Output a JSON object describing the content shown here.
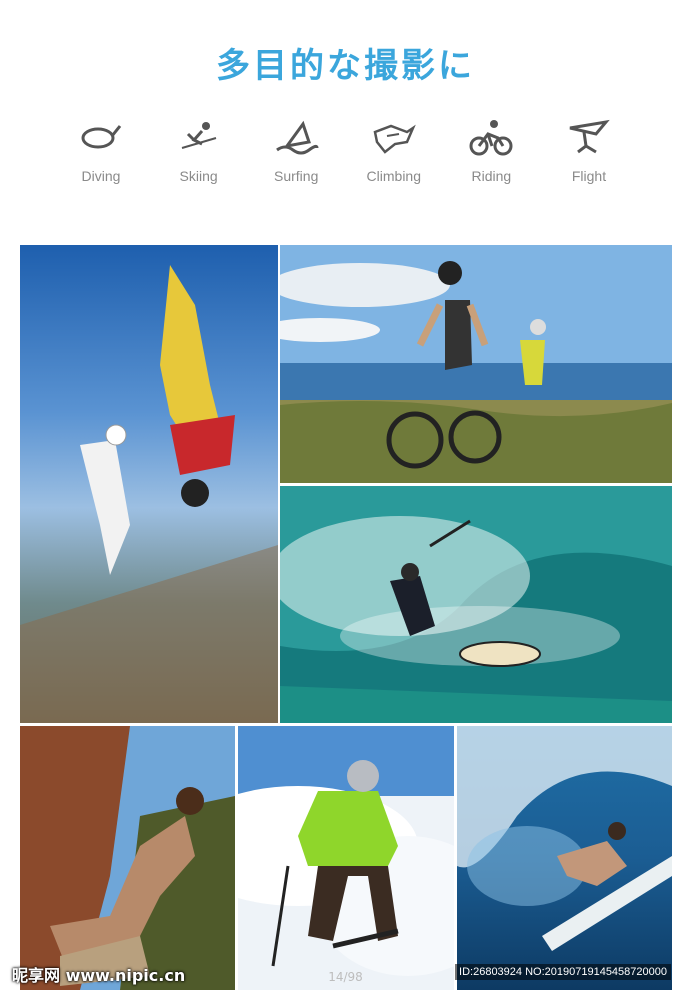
{
  "title": "多目的な撮影に",
  "activities": [
    {
      "label": "Diving",
      "icon": "diving-icon"
    },
    {
      "label": "Skiing",
      "icon": "skiing-icon"
    },
    {
      "label": "Surfing",
      "icon": "surfing-icon"
    },
    {
      "label": "Climbing",
      "icon": "climbing-icon"
    },
    {
      "label": "Riding",
      "icon": "riding-icon"
    },
    {
      "label": "Flight",
      "icon": "flight-icon"
    }
  ],
  "footer": {
    "watermark": "昵享网 www.nipic.cn",
    "page": "14/98",
    "image_id": "ID:26803924 NO:20190719145458720000"
  },
  "colors": {
    "title": "#3ba6dc",
    "label": "#8a8a8a"
  }
}
